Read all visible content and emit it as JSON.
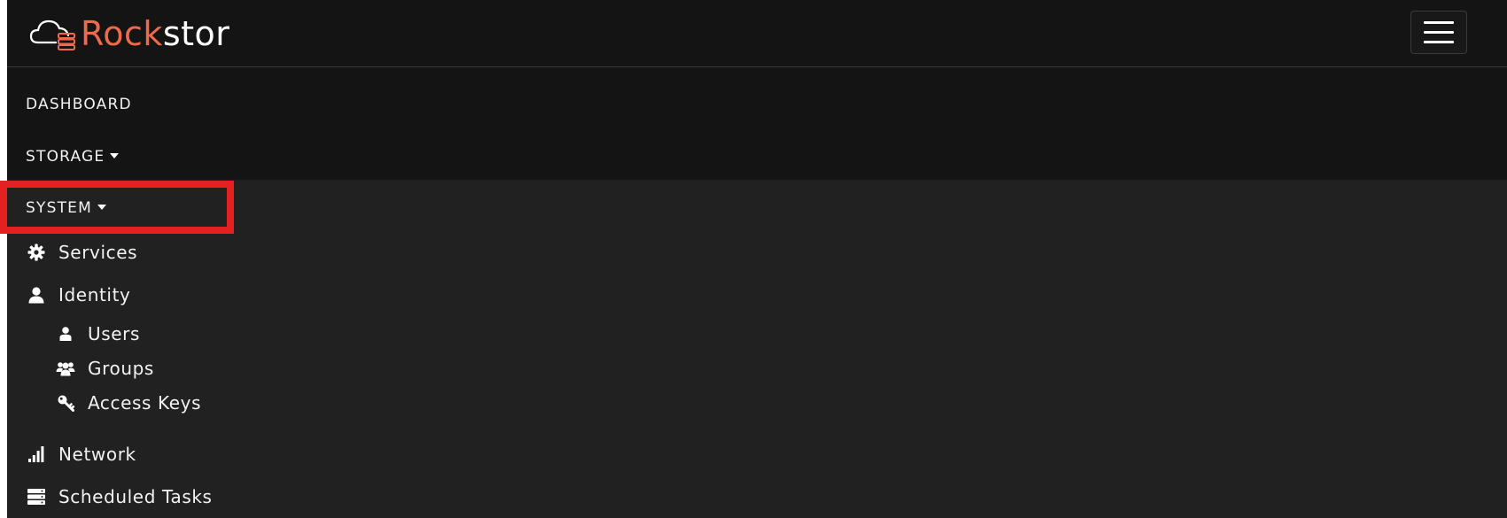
{
  "brand": {
    "name_part1": "Rock",
    "name_part2": "stor",
    "accent_color": "#ef6a4a",
    "logo_icon": "cloud-server-logo"
  },
  "navbar": {
    "toggle_icon": "hamburger-menu-icon"
  },
  "nav": {
    "dashboard_label": "DASHBOARD",
    "storage_label": "STORAGE",
    "system_label": "SYSTEM"
  },
  "system_menu": {
    "services": {
      "label": "Services",
      "icon": "gear-icon"
    },
    "identity": {
      "label": "Identity",
      "icon": "user-icon",
      "children": {
        "users": {
          "label": "Users",
          "icon": "user-icon"
        },
        "groups": {
          "label": "Groups",
          "icon": "users-group-icon"
        },
        "access_keys": {
          "label": "Access Keys",
          "icon": "key-icon"
        }
      }
    },
    "network": {
      "label": "Network",
      "icon": "signal-bars-icon"
    },
    "scheduled_tasks": {
      "label": "Scheduled Tasks",
      "icon": "server-tasks-icon"
    }
  },
  "colors": {
    "navbar_bg": "#141414",
    "dropdown_bg": "#212121",
    "highlight_border": "#e52020",
    "text": "#ffffff"
  }
}
